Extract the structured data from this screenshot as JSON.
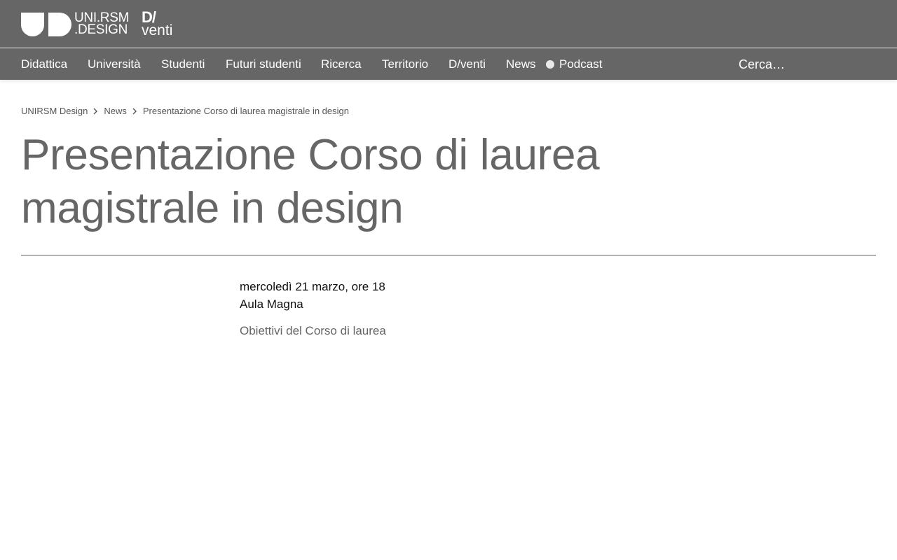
{
  "header": {
    "logo": {
      "line1": "UNI.RSM",
      "line2": ".DESIGN"
    },
    "dventi": {
      "line1": "D/",
      "line2": "venti"
    }
  },
  "nav": {
    "items": [
      {
        "label": "Didattica"
      },
      {
        "label": "Università"
      },
      {
        "label": "Studenti"
      },
      {
        "label": "Futuri studenti"
      },
      {
        "label": "Ricerca"
      },
      {
        "label": "Territorio"
      },
      {
        "label": "D/venti"
      },
      {
        "label": "News"
      },
      {
        "label": "Podcast"
      }
    ],
    "search_placeholder": "Cerca…"
  },
  "breadcrumb": {
    "items": [
      "UNIRSM Design",
      "News",
      "Presentazione Corso di laurea magistrale in design"
    ]
  },
  "page": {
    "title": "Presentazione Corso di laurea magistrale in design",
    "event_date": "mercoledì 21 marzo, ore 18",
    "event_place": "Aula Magna",
    "objectives_link": "Obiettivi del Corso di laurea"
  },
  "colors": {
    "header_bg": "#666666",
    "text_white": "#ffffff",
    "title_gray": "#666666"
  }
}
